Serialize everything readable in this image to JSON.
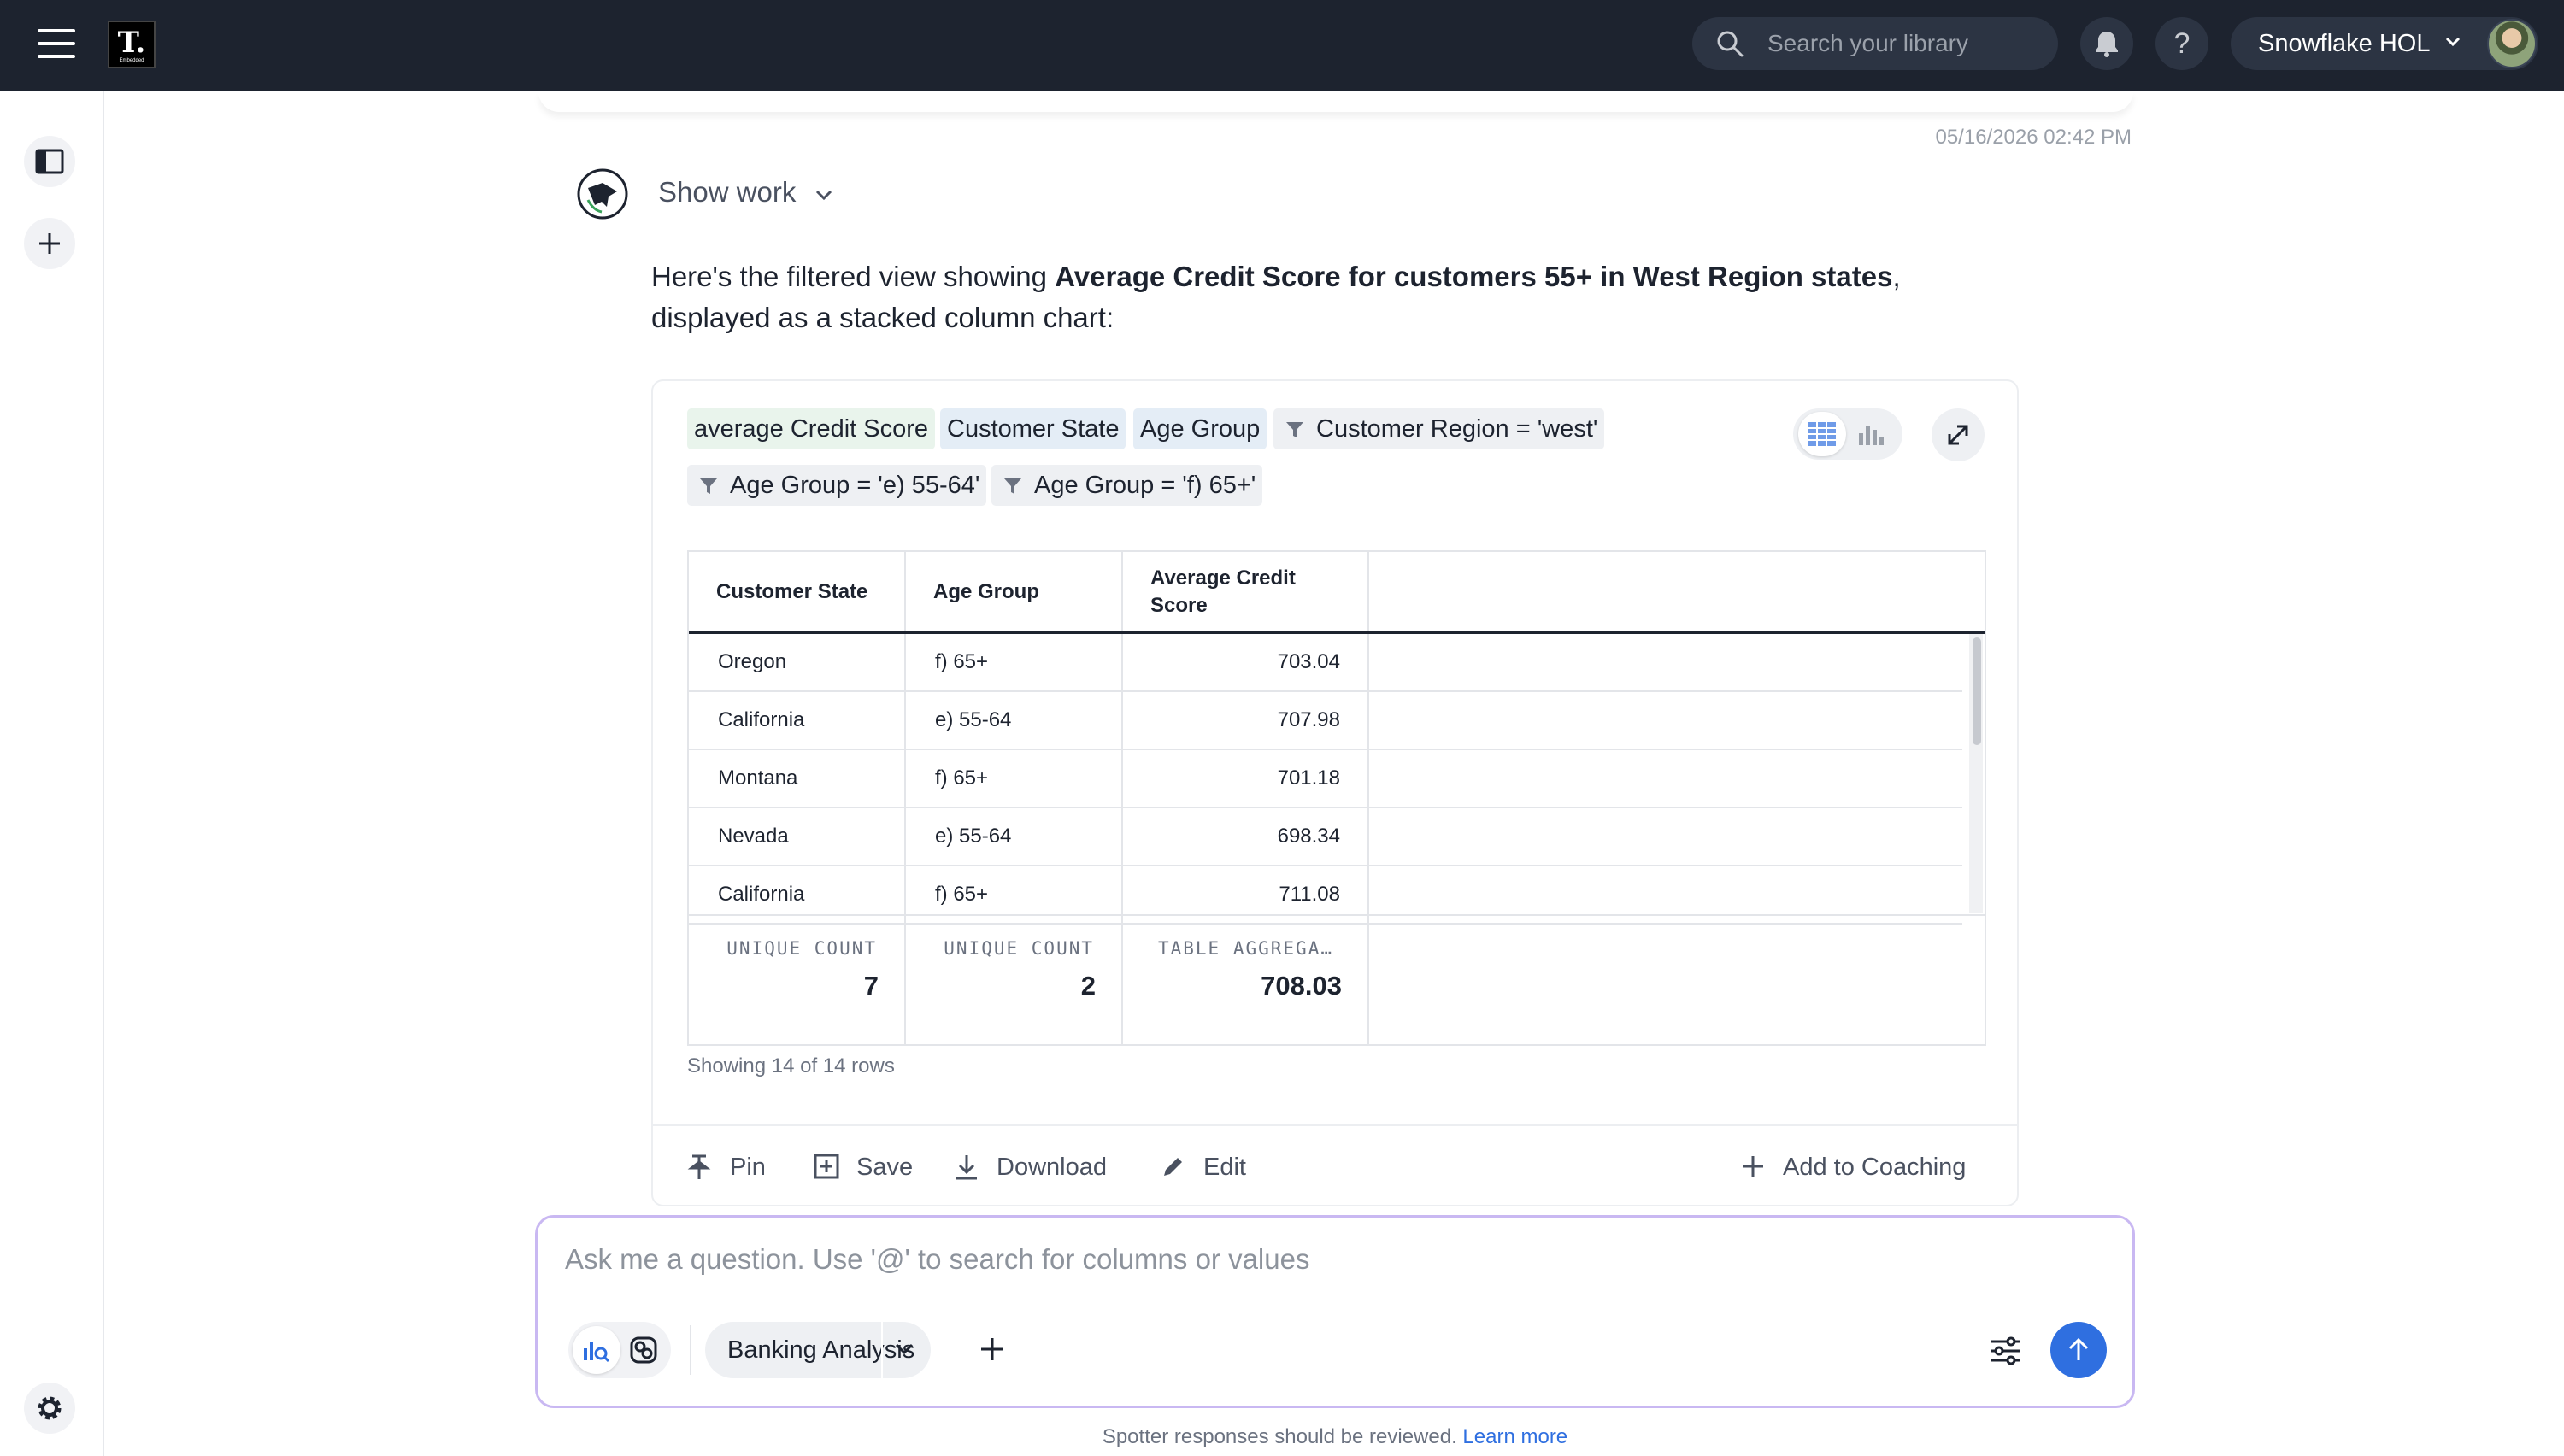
{
  "topbar": {
    "logo_letter": "T.",
    "logo_caption": "Embedded",
    "search_placeholder": "Search your library",
    "help_label": "?",
    "org_name": "Snowflake HOL"
  },
  "conversation": {
    "timestamp": "05/16/2026 02:42 PM",
    "show_work_label": "Show work",
    "answer_prefix": "Here's the filtered view showing ",
    "answer_bold": "Average Credit Score for customers 55+ in West Region states",
    "answer_suffix": ", displayed as a stacked column chart:"
  },
  "card": {
    "tokens": {
      "measure": "average Credit Score",
      "attr1": "Customer State",
      "attr2": "Age Group",
      "filter1": "Customer Region = 'west'",
      "filter2": "Age Group = 'e) 55-64'",
      "filter3": "Age Group = 'f) 65+'"
    },
    "view_toggle": {
      "selected": "table"
    },
    "table": {
      "headers": [
        "Customer State",
        "Age Group",
        "Average Credit Score"
      ],
      "rows": [
        [
          "Oregon",
          "f) 65+",
          "703.04"
        ],
        [
          "California",
          "e) 55-64",
          "707.98"
        ],
        [
          "Montana",
          "f) 65+",
          "701.18"
        ],
        [
          "Nevada",
          "e) 55-64",
          "698.34"
        ],
        [
          "California",
          "f) 65+",
          "711.08"
        ]
      ],
      "footer": {
        "c1_label": "UNIQUE COUNT",
        "c1_value": "7",
        "c2_label": "UNIQUE COUNT",
        "c2_value": "2",
        "c3_label": "TABLE AGGREGA…",
        "c3_value": "708.03"
      }
    },
    "rows_info": "Showing 14 of 14 rows",
    "actions": {
      "pin": "Pin",
      "save": "Save",
      "download": "Download",
      "edit": "Edit",
      "coaching": "Add to Coaching"
    }
  },
  "ask": {
    "placeholder": "Ask me a question. Use '@' to search for columns or values",
    "dataset": "Banking Analysis"
  },
  "footer": {
    "disclaimer": "Spotter responses should be reviewed.",
    "learn_more": "Learn more"
  },
  "colors": {
    "topbar": "#1d232f",
    "accent": "#2f6fe0",
    "measure_chip": "#e9f4ec",
    "attribute_chip": "#e4edf6",
    "filter_chip": "#eef0f3"
  }
}
